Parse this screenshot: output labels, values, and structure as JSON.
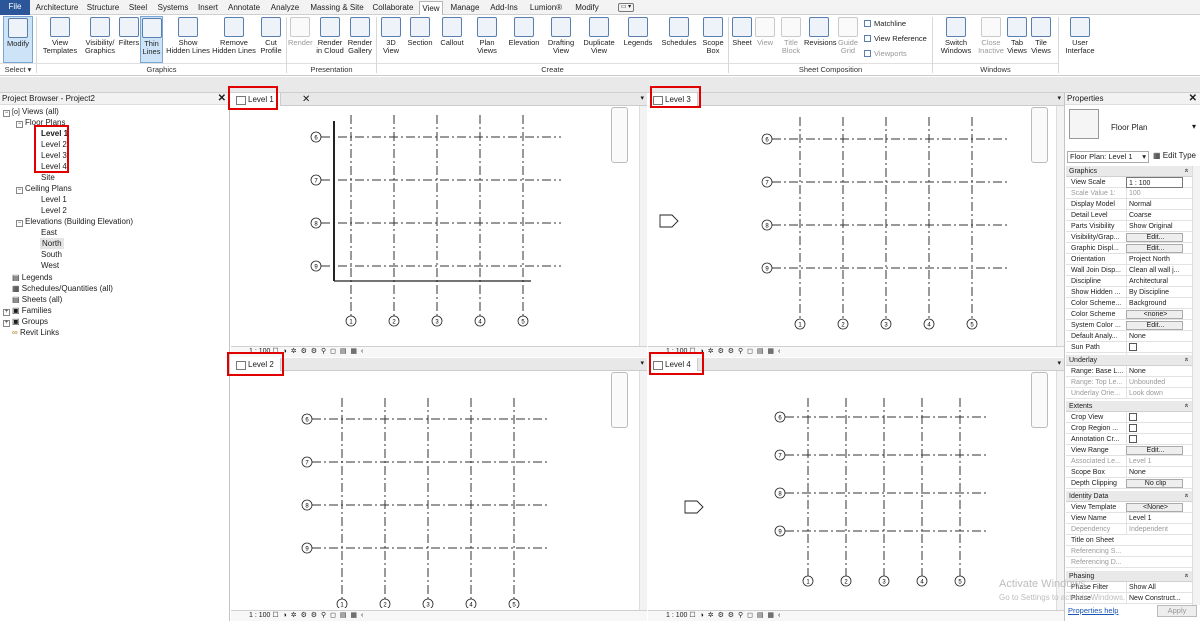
{
  "ribbon_tabs": [
    {
      "label": "File",
      "active": false
    },
    {
      "label": "Architecture",
      "active": false
    },
    {
      "label": "Structure",
      "active": false
    },
    {
      "label": "Steel",
      "active": false
    },
    {
      "label": "Systems",
      "active": false
    },
    {
      "label": "Insert",
      "active": false
    },
    {
      "label": "Annotate",
      "active": false
    },
    {
      "label": "Analyze",
      "active": false
    },
    {
      "label": "Massing & Site",
      "active": false
    },
    {
      "label": "Collaborate",
      "active": false
    },
    {
      "label": "View",
      "active": true
    },
    {
      "label": "Manage",
      "active": false
    },
    {
      "label": "Add-Ins",
      "active": false
    },
    {
      "label": "Lumion®",
      "active": false
    },
    {
      "label": "Modify",
      "active": false
    }
  ],
  "quick_button": "▭ ▾",
  "ribbon": {
    "modify": "Modify",
    "view_templates": "View\nTemplates",
    "visibility_graphics": "Visibility/\nGraphics",
    "filters": "Filters",
    "thin_lines": "Thin\nLines",
    "show_hidden_lines": "Show\nHidden Lines",
    "remove_hidden_lines": "Remove\nHidden Lines",
    "cut_profile": "Cut\nProfile",
    "render": "Render",
    "render_in_cloud": "Render\nin Cloud",
    "render_gallery": "Render\nGallery",
    "3d_view": "3D\nView",
    "section": "Section",
    "callout": "Callout",
    "plan_views": "Plan\nViews",
    "elevation": "Elevation",
    "drafting_view": "Drafting\nView",
    "duplicate_view": "Duplicate\nView",
    "legends": "Legends",
    "schedules": "Schedules",
    "scope_box": "Scope\nBox",
    "sheet": "Sheet",
    "view": "View",
    "title_block": "Title\nBlock",
    "revisions": "Revisions",
    "guide_grid": "Guide\nGrid",
    "matchline": "Matchline",
    "view_reference": "View Reference",
    "viewports": "Viewports",
    "switch_windows": "Switch\nWindows",
    "close_inactive": "Close\nInactive",
    "tab_views": "Tab\nViews",
    "tile_views": "Tile\nViews",
    "user_interface": "User\nInterface",
    "panels": {
      "select": "Select ▾",
      "graphics": "Graphics",
      "presentation": "Presentation",
      "create": "Create",
      "sheet_composition": "Sheet Composition",
      "windows": "Windows"
    }
  },
  "browser": {
    "title": "Project Browser - Project2",
    "items": [
      {
        "label": "Views (all)"
      },
      {
        "label": "Floor Plans"
      },
      {
        "label": "Level 1"
      },
      {
        "label": "Level 2"
      },
      {
        "label": "Level 3"
      },
      {
        "label": "Level 4"
      },
      {
        "label": "Site"
      },
      {
        "label": "Ceiling Plans"
      },
      {
        "label": "Level 1"
      },
      {
        "label": "Level 2"
      },
      {
        "label": "Elevations (Building Elevation)"
      },
      {
        "label": "East"
      },
      {
        "label": "North"
      },
      {
        "label": "South"
      },
      {
        "label": "West"
      },
      {
        "label": "Legends"
      },
      {
        "label": "Schedules/Quantities (all)"
      },
      {
        "label": "Sheets (all)"
      },
      {
        "label": "Families"
      },
      {
        "label": "Groups"
      },
      {
        "label": "Revit Links"
      }
    ]
  },
  "views": [
    {
      "tab": "Level 1",
      "scale": "1 : 100",
      "close": "✕"
    },
    {
      "tab": "Level 3",
      "scale": "1 : 100"
    },
    {
      "tab": "Level 2",
      "scale": "1 : 100"
    },
    {
      "tab": "Level 4",
      "scale": "1 : 100"
    }
  ],
  "grid": {
    "rows": [
      "6",
      "7",
      "8",
      "9"
    ],
    "cols": [
      "1",
      "2",
      "3",
      "4",
      "5"
    ]
  },
  "properties": {
    "title": "Properties",
    "type_name": "Floor Plan",
    "selector": "Floor Plan: Level 1",
    "edit_type": "Edit Type",
    "groups": {
      "graphics": "Graphics",
      "underlay": "Underlay",
      "extents": "Extents",
      "identity": "Identity Data",
      "phasing": "Phasing"
    },
    "rows": [
      {
        "k": "View Scale",
        "v": "1 : 100"
      },
      {
        "k": "Scale Value    1:",
        "v": "100"
      },
      {
        "k": "Display Model",
        "v": "Normal"
      },
      {
        "k": "Detail Level",
        "v": "Coarse"
      },
      {
        "k": "Parts Visibility",
        "v": "Show Original"
      },
      {
        "k": "Visibility/Grap...",
        "v": "Edit..."
      },
      {
        "k": "Graphic Displ...",
        "v": "Edit..."
      },
      {
        "k": "Orientation",
        "v": "Project North"
      },
      {
        "k": "Wall Join Disp...",
        "v": "Clean all wall j..."
      },
      {
        "k": "Discipline",
        "v": "Architectural"
      },
      {
        "k": "Show Hidden ...",
        "v": "By Discipline"
      },
      {
        "k": "Color Scheme...",
        "v": "Background"
      },
      {
        "k": "Color Scheme",
        "v": "<none>"
      },
      {
        "k": "System Color ...",
        "v": "Edit..."
      },
      {
        "k": "Default Analy...",
        "v": "None"
      },
      {
        "k": "Sun Path",
        "v": ""
      },
      {
        "k": "Range: Base L...",
        "v": "None"
      },
      {
        "k": "Range: Top Le...",
        "v": "Unbounded"
      },
      {
        "k": "Underlay Orie...",
        "v": "Look down"
      },
      {
        "k": "Crop View",
        "v": ""
      },
      {
        "k": "Crop Region ...",
        "v": ""
      },
      {
        "k": "Annotation Cr...",
        "v": ""
      },
      {
        "k": "View Range",
        "v": "Edit..."
      },
      {
        "k": "Associated Le...",
        "v": "Level 1"
      },
      {
        "k": "Scope Box",
        "v": "None"
      },
      {
        "k": "Depth Clipping",
        "v": "No clip"
      },
      {
        "k": "View Template",
        "v": "<None>"
      },
      {
        "k": "View Name",
        "v": "Level 1"
      },
      {
        "k": "Dependency",
        "v": "Independent"
      },
      {
        "k": "Title on Sheet",
        "v": ""
      },
      {
        "k": "Referencing S...",
        "v": ""
      },
      {
        "k": "Referencing D...",
        "v": ""
      },
      {
        "k": "Phase Filter",
        "v": "Show All"
      },
      {
        "k": "Phase",
        "v": "New Construct..."
      }
    ],
    "help": "Properties help",
    "apply": "Apply"
  },
  "watermark": {
    "line1": "Activate Windows",
    "line2": "Go to Settings to activate Windows."
  }
}
